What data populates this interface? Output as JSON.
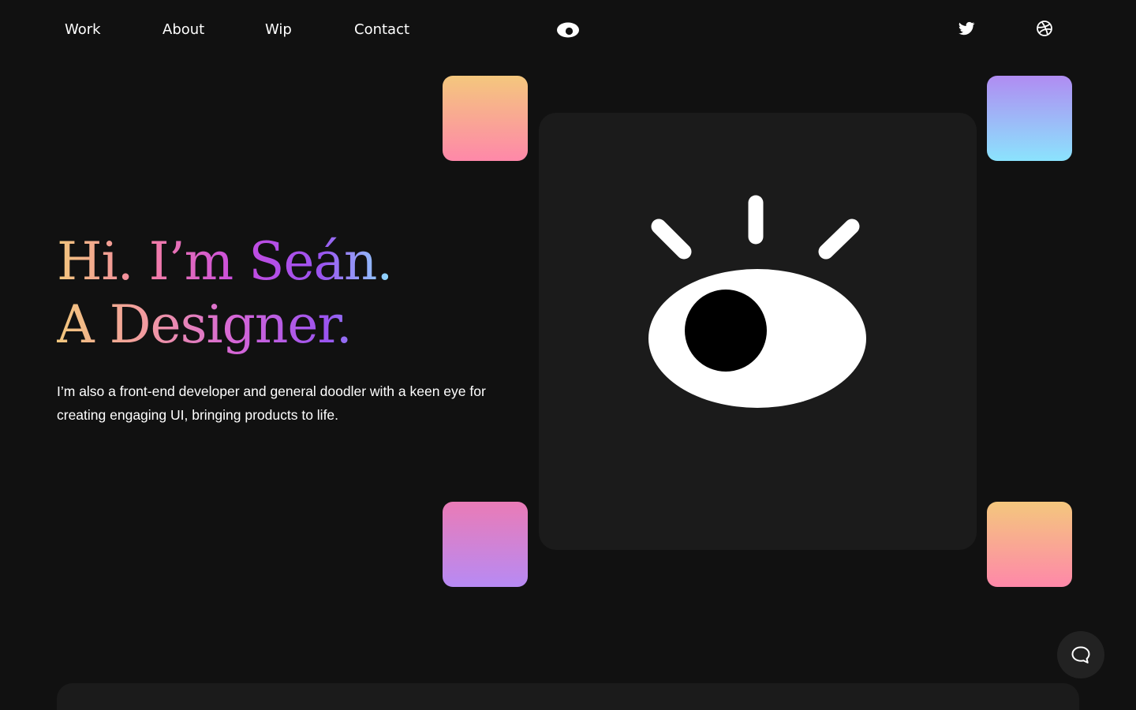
{
  "nav": {
    "links": [
      {
        "label": "Work"
      },
      {
        "label": "About"
      },
      {
        "label": "Wip"
      },
      {
        "label": "Contact"
      }
    ],
    "logo_icon": "eye-icon",
    "social": [
      {
        "icon": "twitter-icon"
      },
      {
        "icon": "dribbble-icon"
      }
    ]
  },
  "hero": {
    "headline_line1": "Hi. I’m Seán.",
    "headline_line2": "A Designer.",
    "intro": "I’m also a front-end developer and general doodler with a keen eye for creating engaging UI, bringing products to life."
  },
  "illustration": {
    "icon": "eye-illustration",
    "tiles": [
      {
        "gradient": [
          "#f4c77d",
          "#fe88a9"
        ]
      },
      {
        "gradient": [
          "#b08cf2",
          "#8be3fd"
        ]
      },
      {
        "gradient": [
          "#ea7bb6",
          "#b78af4"
        ]
      },
      {
        "gradient": [
          "#f4c77d",
          "#fe88a9"
        ]
      }
    ]
  },
  "chat": {
    "icon": "chat-bubble-icon"
  },
  "colors": {
    "background": "#111111",
    "card": "#1b1b1b",
    "text": "#ffffff"
  }
}
